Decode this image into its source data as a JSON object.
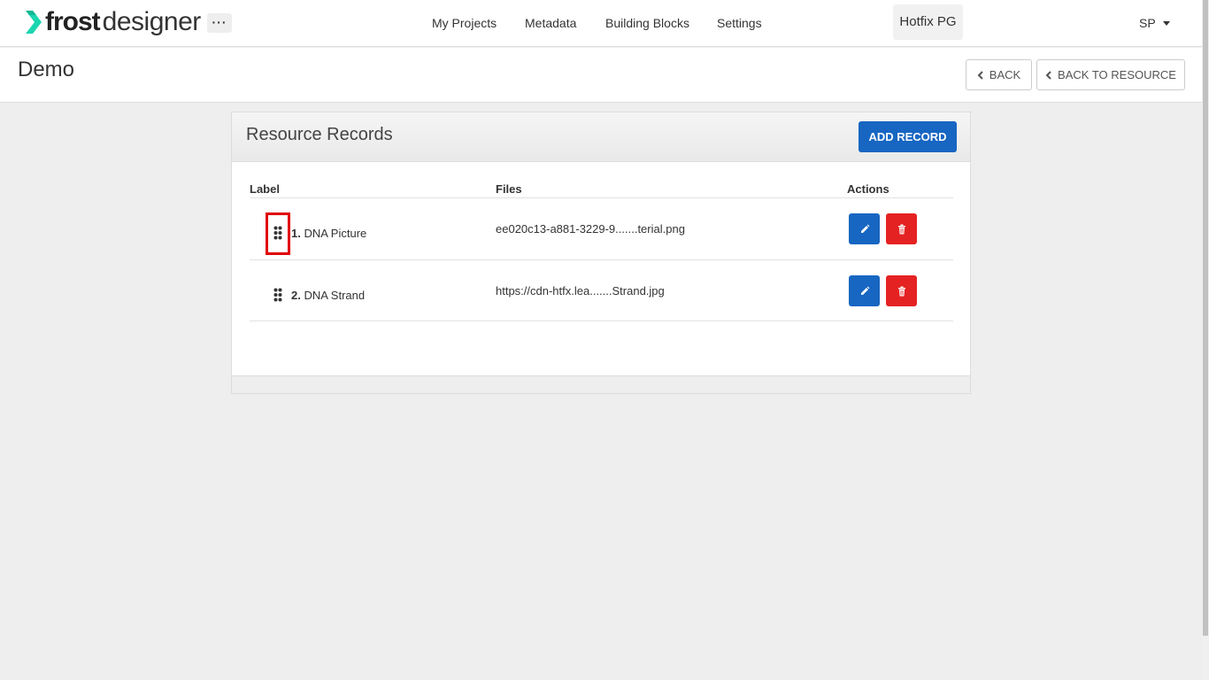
{
  "brand": {
    "bold": "frost",
    "light": "designer",
    "accent": "#1ad6b0"
  },
  "nav": {
    "more": "···",
    "links": [
      "My Projects",
      "Metadata",
      "Building Blocks",
      "Settings"
    ],
    "environment": "Hotfix PG",
    "user": "SP"
  },
  "page": {
    "title": "Demo",
    "back": "BACK",
    "back_to_resource": "BACK TO RESOURCE"
  },
  "panel": {
    "title": "Resource Records",
    "add_button": "ADD RECORD",
    "columns": {
      "label": "Label",
      "files": "Files",
      "actions": "Actions"
    },
    "rows": [
      {
        "index": "1.",
        "label": "DNA Picture",
        "file": "ee020c13-a881-3229-9.......terial.png"
      },
      {
        "index": "2.",
        "label": "DNA Strand",
        "file": "https://cdn-htfx.lea.......Strand.jpg"
      }
    ]
  },
  "colors": {
    "primary": "#1766c2",
    "danger": "#e52222",
    "highlight": "#e00000"
  }
}
